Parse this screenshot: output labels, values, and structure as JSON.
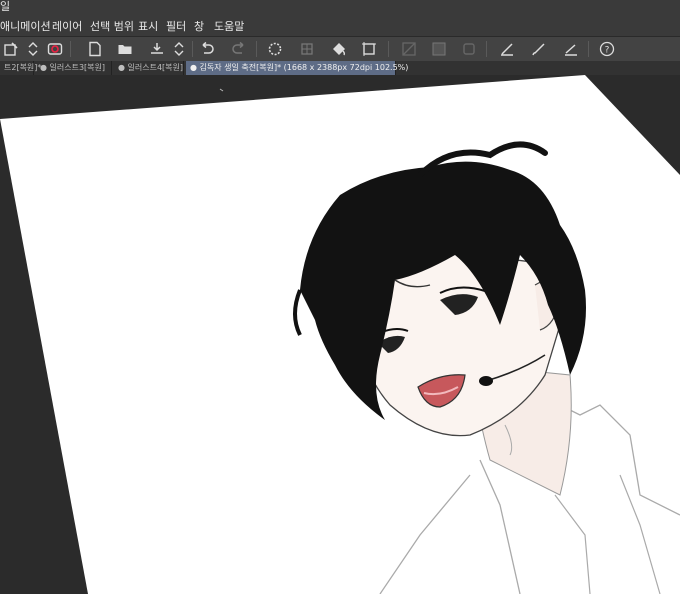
{
  "window": {
    "title_fragment": "일"
  },
  "menu": [
    "애니메이션",
    "레이어",
    "선택 범위",
    "표시",
    "필터",
    "창",
    "도움말"
  ],
  "toolbar": {
    "icons": [
      "new-icon",
      "spinner-icon",
      "camera-icon",
      "new-file-icon",
      "open-folder-icon",
      "save-icon",
      "spinner-icon",
      "undo-icon",
      "redo-icon",
      "loading-icon",
      "transform-icon",
      "fill-icon",
      "select-icon",
      "clear-icon",
      "fill-selection-icon",
      "square-icon",
      "pen-icon",
      "brush-icon",
      "ruler-icon",
      "help-icon"
    ]
  },
  "tabs": [
    {
      "label": "트2[복원]*"
    },
    {
      "label": "일러스트3[복원]"
    },
    {
      "label": "일러스트4[복원]"
    },
    {
      "label": "김독자 생일 축전[복원]* (1668 x 2388px 72dpi 102.5%)"
    }
  ],
  "colors": {
    "menubar": "#3a3a3a",
    "toolbar": "#434343",
    "tab_active": "#5e6c86",
    "canvas_bg": "#2b2b2b",
    "paper": "#ffffff",
    "hair": "#121212",
    "skin": "#f7ece7",
    "mouth": "#c7585c"
  }
}
